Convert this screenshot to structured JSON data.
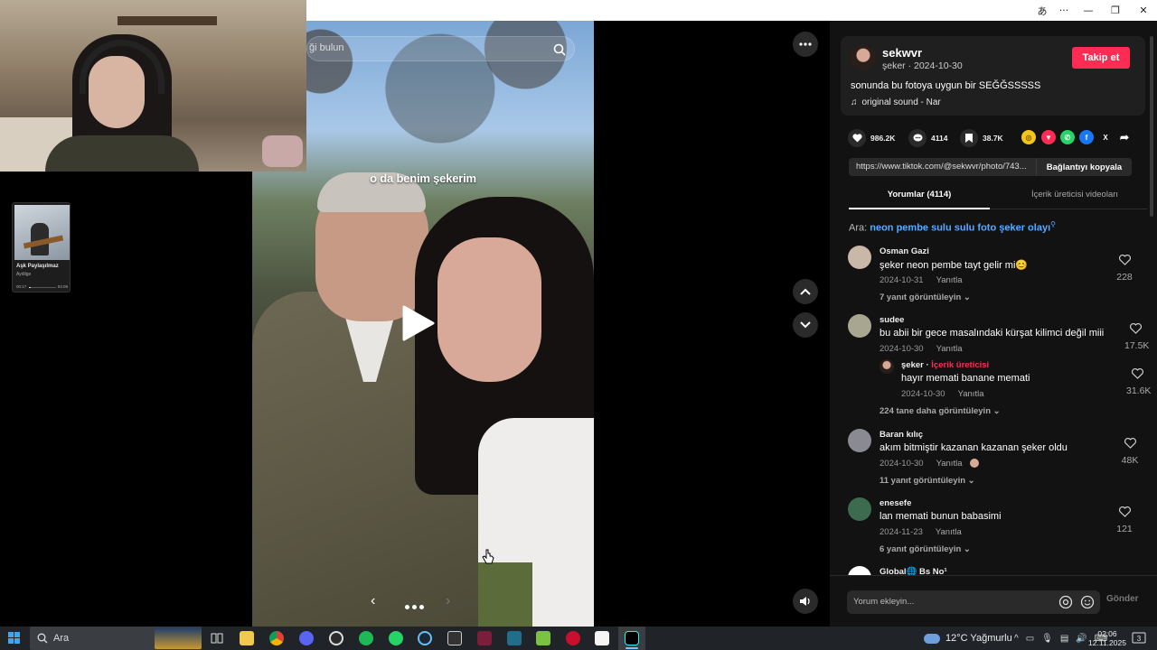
{
  "video": {
    "search_placeholder": "ği bulun",
    "caption": "o da benim şekerim"
  },
  "mini_player": {
    "title": "Aşk Paylaşılmaz",
    "artist": "Aydilge",
    "time_elapsed": "00:17",
    "time_total": "04:09",
    "progress": 0.07
  },
  "author": {
    "name": "sekwvr",
    "sub": "şeker · 2024-10-30",
    "follow_label": "Takip et",
    "description": "sonunda bu fotoya uygun bir SEĞĞSSSSS",
    "sound": "original sound - Nar"
  },
  "stats": {
    "likes": "986.2K",
    "comments": "4114",
    "saves": "38.7K"
  },
  "share_link": {
    "url": "https://www.tiktok.com/@sekwvr/photo/743...",
    "copy_label": "Bağlantıyı kopyala"
  },
  "tabs": {
    "comments": "Yorumlar (4114)",
    "creator_videos": "İçerik üreticisi videoları"
  },
  "search_suggest": {
    "prefix": "Ara:",
    "term": "neon pembe sulu sulu foto şeker olayı"
  },
  "reply_label": "Yanıtla",
  "comments": [
    {
      "name": "Osman Gazi",
      "text": "şeker neon pembe tayt gelir mi😊",
      "date": "2024-10-31",
      "likes": "228",
      "more": "7 yanıt görüntüleyin",
      "avatar_color": "#c9b7a8"
    },
    {
      "name": "sudee",
      "text": "bu abii bir gece masalındaki kürşat kilimci değil miii",
      "date": "2024-10-30",
      "likes": "17.5K",
      "more": "",
      "avatar_color": "#a8a690"
    },
    {
      "name": "Baran kılıç",
      "text": "akım bitmiştir kazanan kazanan şeker oldu",
      "date": "2024-10-30",
      "likes": "48K",
      "more": "11 yanıt görüntüleyin",
      "avatar_color": "#8a8a92"
    },
    {
      "name": "enesefe",
      "text": "lan memati bunun babasimi",
      "date": "2024-11-23",
      "likes": "121",
      "more": "6 yanıt görüntüleyin",
      "avatar_color": "#3c6b50"
    },
    {
      "name": "Global🌐 Bs No¹",
      "text": "",
      "date": "",
      "likes": "",
      "more": "",
      "avatar_color": "#ffffff"
    }
  ],
  "creator_reply": {
    "name": "şeker",
    "badge": "İçerik üreticisi",
    "text": "hayır memati banane memati",
    "date": "2024-10-30",
    "likes": "31.6K",
    "more": "224 tane daha görüntüleyin"
  },
  "comment_input": {
    "placeholder": "Yorum ekleyin...",
    "send_label": "Gönder"
  },
  "taskbar": {
    "search_label": "Ara",
    "weather": "12°C  Yağmurlu",
    "time": "02:06",
    "date": "12.11.2025",
    "notifications": "3"
  },
  "colors": {
    "accent": "#fe2c55",
    "link": "#5aa9ff",
    "panel_bg": "#121212"
  }
}
